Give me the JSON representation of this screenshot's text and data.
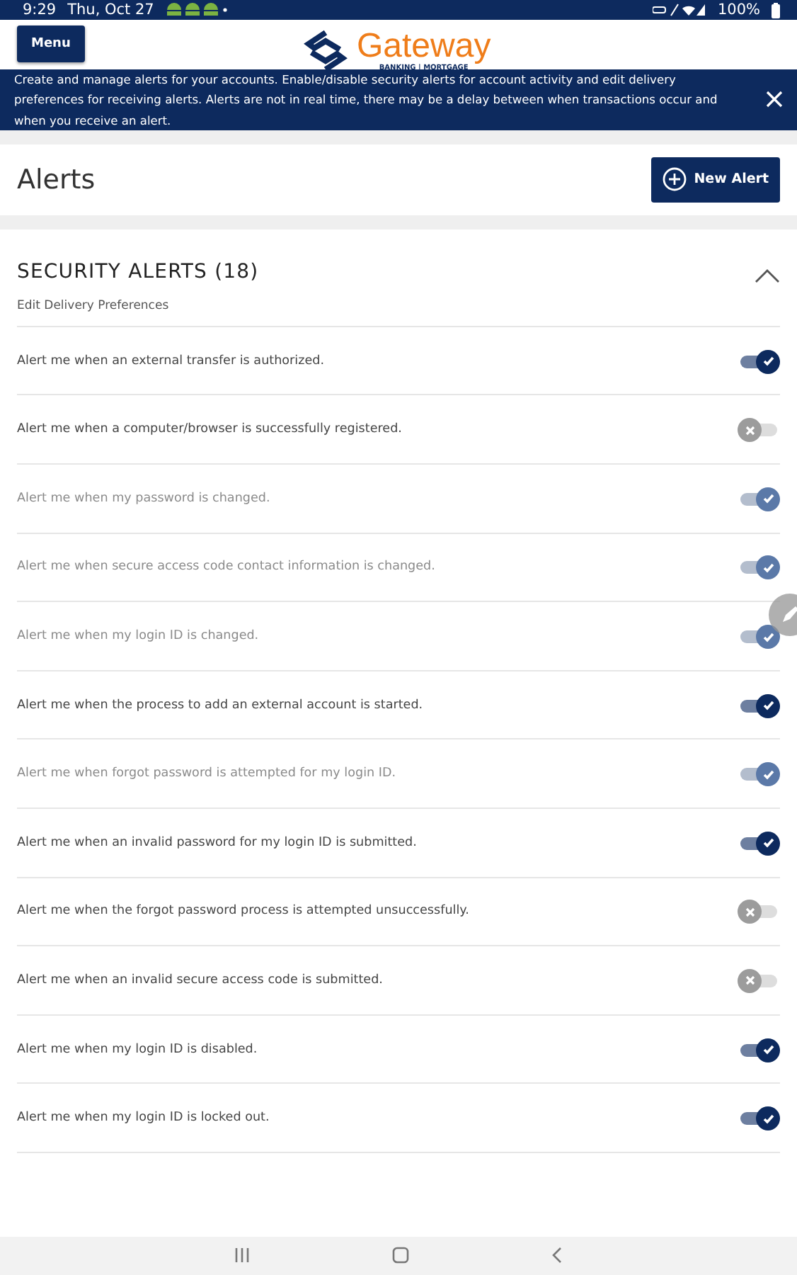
{
  "status_bar": {
    "time": "9:29",
    "date": "Thu, Oct 27",
    "battery": "100%"
  },
  "header": {
    "menu_button": "Menu",
    "logo": {
      "name": "Gateway",
      "tagline": "BANKING | MORTGAGE"
    }
  },
  "banner": {
    "text": "Create and manage alerts for your accounts. Enable/disable security alerts for account activity and edit delivery preferences for receiving alerts. Alerts are not in real time, there may be a delay between when transactions occur and when you receive an alert."
  },
  "page": {
    "title": "Alerts",
    "new_alert_button": "New Alert"
  },
  "section": {
    "title": "SECURITY ALERTS (18)",
    "expanded": true,
    "link": "Edit Delivery Preferences",
    "alerts": [
      {
        "label": "Alert me when an external transfer is authorized.",
        "on": true,
        "disabled": false
      },
      {
        "label": "Alert me when a computer/browser is successfully registered.",
        "on": false,
        "disabled": false
      },
      {
        "label": "Alert me when my password is changed.",
        "on": true,
        "disabled": true
      },
      {
        "label": "Alert me when secure access code contact information is changed.",
        "on": true,
        "disabled": true
      },
      {
        "label": "Alert me when my login ID is changed.",
        "on": true,
        "disabled": true
      },
      {
        "label": "Alert me when the process to add an external account is started.",
        "on": true,
        "disabled": false
      },
      {
        "label": "Alert me when forgot password is attempted for my login ID.",
        "on": true,
        "disabled": true
      },
      {
        "label": "Alert me when an invalid password for my login ID is submitted.",
        "on": true,
        "disabled": false
      },
      {
        "label": "Alert me when the forgot password process is attempted unsuccessfully.",
        "on": false,
        "disabled": false
      },
      {
        "label": "Alert me when an invalid secure access code is submitted.",
        "on": false,
        "disabled": false
      },
      {
        "label": "Alert me when my login ID is disabled.",
        "on": true,
        "disabled": false
      },
      {
        "label": "Alert me when my login ID is locked out.",
        "on": true,
        "disabled": false
      }
    ]
  }
}
